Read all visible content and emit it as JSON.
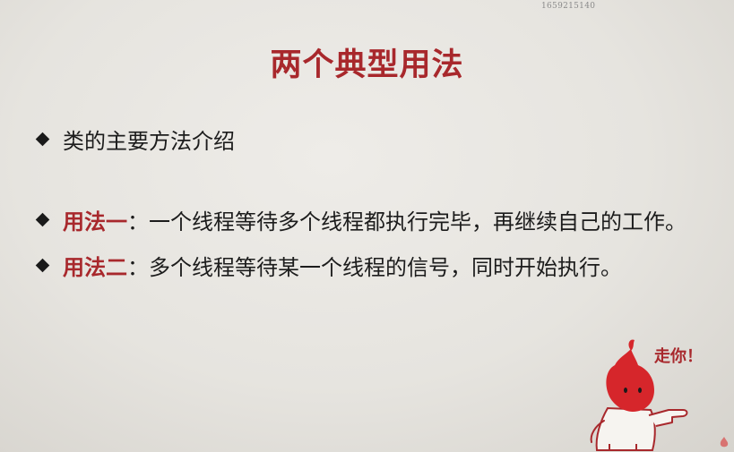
{
  "slide": {
    "watermark": "1659215140",
    "title": "两个典型用法",
    "bullets": [
      {
        "text": "类的主要方法介绍"
      },
      {
        "label": "用法一",
        "text": "：一个线程等待多个线程都执行完毕，再继续自己的工作。"
      },
      {
        "label": "用法二",
        "text": "：多个线程等待某一个线程的信号，同时开始执行。"
      }
    ],
    "mascot_speech": "走你！"
  },
  "colors": {
    "title": "#a8282c",
    "accent": "#a8282c",
    "text": "#1c1c1c",
    "background": "#e8e6e1"
  },
  "icons": [
    "diamond-bullet-icon",
    "mascot-icon"
  ]
}
